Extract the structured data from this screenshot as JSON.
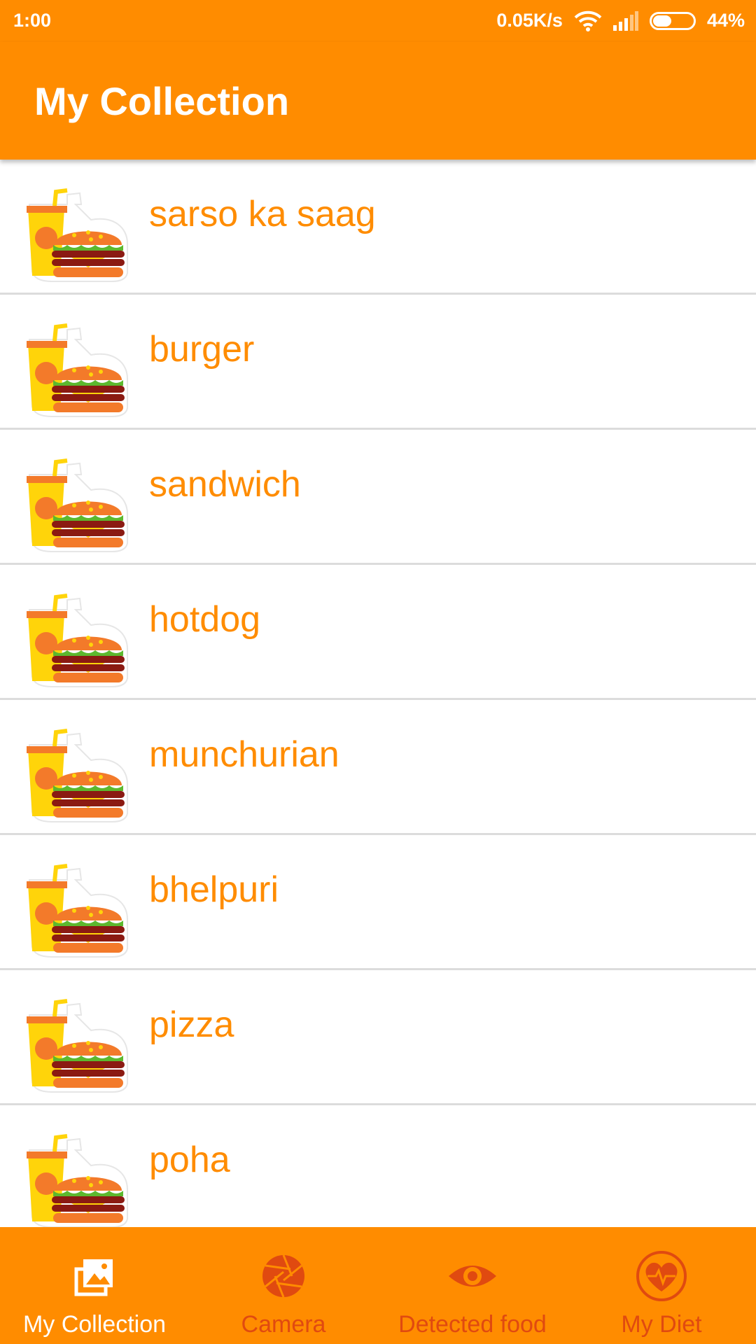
{
  "status_bar": {
    "time": "1:00",
    "speed": "0.05K/s",
    "battery_percent_label": "44%",
    "battery_level": 0.44,
    "icons": [
      "wifi-icon",
      "signal-icon",
      "battery-icon"
    ]
  },
  "app_bar": {
    "title": "My Collection"
  },
  "collection": {
    "items": [
      {
        "label": "sarso ka saag"
      },
      {
        "label": "burger"
      },
      {
        "label": "sandwich"
      },
      {
        "label": "hotdog"
      },
      {
        "label": "munchurian"
      },
      {
        "label": "bhelpuri"
      },
      {
        "label": "pizza"
      },
      {
        "label": "poha"
      }
    ],
    "item_icon": "fast-food-icon"
  },
  "bottom_nav": {
    "items": [
      {
        "label": "My Collection",
        "icon": "gallery-icon",
        "active": true
      },
      {
        "label": "Camera",
        "icon": "camera-aperture-icon",
        "active": false
      },
      {
        "label": "Detected food",
        "icon": "eye-icon",
        "active": false
      },
      {
        "label": "My Diet",
        "icon": "heart-pulse-icon",
        "active": false
      }
    ]
  },
  "colors": {
    "primary": "#ff8c00",
    "inactive_nav": "#e04a10",
    "active_nav": "#ffffff",
    "divider": "#dcdcdc"
  }
}
